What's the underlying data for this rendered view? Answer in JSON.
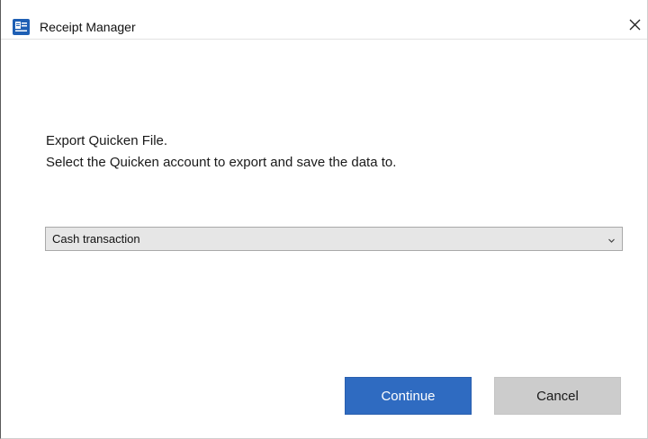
{
  "window": {
    "title": "Receipt Manager",
    "app_icon": "receipt-manager-app-icon",
    "close_icon": "close-icon"
  },
  "prompt": {
    "line1": "Export Quicken File.",
    "line2": "Select the Quicken account to export and save the data to."
  },
  "account_select": {
    "selected": "Cash transaction",
    "icon": "chevron-down-icon"
  },
  "buttons": {
    "continue_label": "Continue",
    "cancel_label": "Cancel"
  },
  "colors": {
    "primary_button": "#2f6bc1",
    "secondary_button": "#cccccc",
    "app_icon_blue": "#1e5fb4"
  }
}
